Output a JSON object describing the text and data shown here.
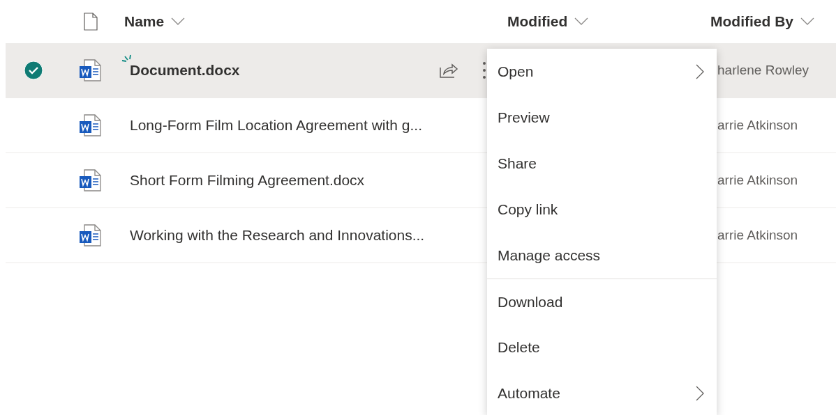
{
  "columns": [
    {
      "label": "Name"
    },
    {
      "label": "Modified"
    },
    {
      "label": "Modified By"
    }
  ],
  "rows": [
    {
      "name": "Document.docx",
      "modified_by": "harlene Rowley",
      "selected": true,
      "is_new": true
    },
    {
      "name": "Long-Form Film Location Agreement with g...",
      "modified_by": "arrie Atkinson",
      "selected": false,
      "is_new": false
    },
    {
      "name": "Short Form Filming Agreement.docx",
      "modified_by": "arrie Atkinson",
      "selected": false,
      "is_new": false
    },
    {
      "name": "Working with the Research and Innovations...",
      "modified_by": "arrie Atkinson",
      "selected": false,
      "is_new": false
    }
  ],
  "context_menu": [
    {
      "label": "Open",
      "has_submenu": true,
      "divider_before": false
    },
    {
      "label": "Preview",
      "has_submenu": false,
      "divider_before": false
    },
    {
      "label": "Share",
      "has_submenu": false,
      "divider_before": false
    },
    {
      "label": "Copy link",
      "has_submenu": false,
      "divider_before": false
    },
    {
      "label": "Manage access",
      "has_submenu": false,
      "divider_before": false
    },
    {
      "label": "Download",
      "has_submenu": false,
      "divider_before": true
    },
    {
      "label": "Delete",
      "has_submenu": false,
      "divider_before": false
    },
    {
      "label": "Automate",
      "has_submenu": true,
      "divider_before": false
    }
  ]
}
